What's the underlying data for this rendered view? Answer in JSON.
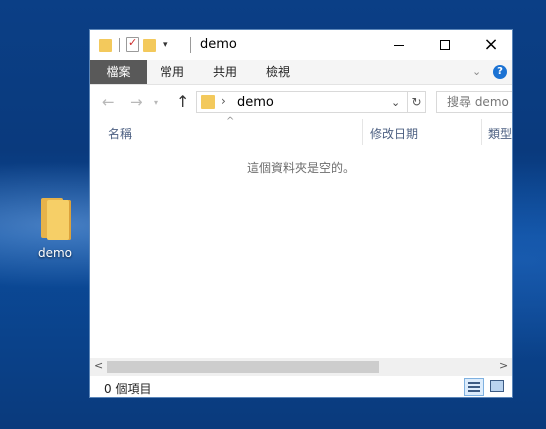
{
  "desktop": {
    "icon_label": "demo"
  },
  "window": {
    "title": "demo",
    "controls": {
      "minimize": "—",
      "maximize": "□",
      "close": "✕"
    }
  },
  "ribbon": {
    "tabs": [
      "檔案",
      "常用",
      "共用",
      "檢視"
    ],
    "help": "?"
  },
  "address": {
    "path": "demo",
    "search_placeholder": "搜尋 demo"
  },
  "columns": {
    "name": "名稱",
    "date_modified": "修改日期",
    "type": "類型"
  },
  "content": {
    "empty_message": "這個資料夾是空的。"
  },
  "status": {
    "item_count": "0 個項目"
  },
  "colors": {
    "accent": "#1b72d3",
    "file_tab": "#595959",
    "desktop": "#0b3f86"
  }
}
